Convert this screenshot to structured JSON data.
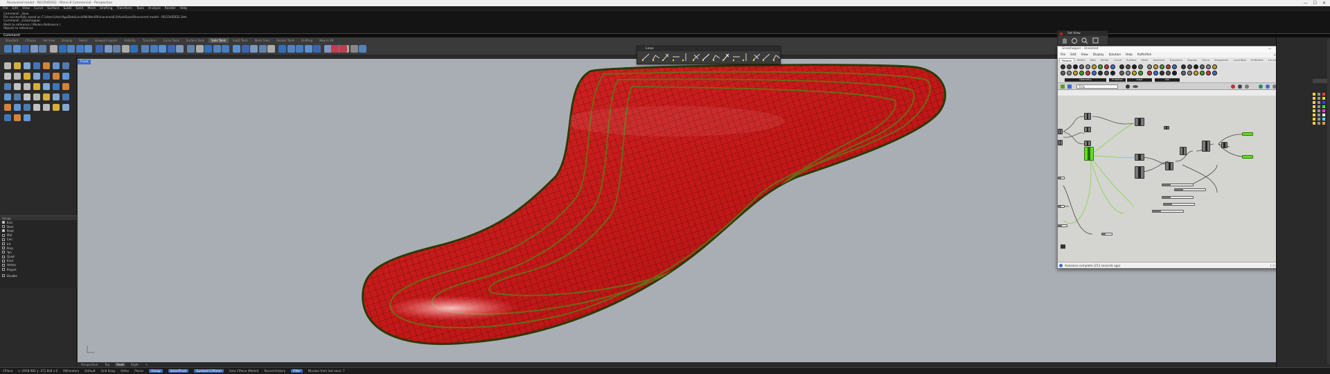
{
  "window": {
    "title": "Recovered model - RECOVERED - Rhino 8 Commercial - Perspective",
    "controls": [
      "—",
      "☐",
      "✕"
    ]
  },
  "menubar": [
    "File",
    "Edit",
    "View",
    "Curve",
    "Surface",
    "SubD",
    "Solid",
    "Mesh",
    "Drafting",
    "Transform",
    "Tools",
    "Analyze",
    "Render",
    "Help"
  ],
  "command_history": [
    "Command: _Save",
    "File successfully saved as C:\\Users\\User\\AppData\\Local\\McNeel\\Rhinoceros\\8.0\\AutoSave\\Recovered model - RECOVERED.3dm",
    "Command: _Grasshopper",
    "Mesh to reference ( Model=Reference )",
    "Objects to reference"
  ],
  "command_prompt": "Command:",
  "toolbar_tabs": [
    "Standard",
    "CPlanes",
    "Set View",
    "Display",
    "Select",
    "Viewport Layout",
    "Visibility",
    "Transform",
    "Curve Tools",
    "Surface Tools",
    "Solid Tools",
    "SubD Tools",
    "Mesh Tools",
    "Render Tools",
    "Drafting",
    "New in V8"
  ],
  "toolbar_active_tab": "Solid Tools",
  "osnap": {
    "header": "Osnap",
    "items": [
      {
        "label": "End",
        "on": true
      },
      {
        "label": "Near",
        "on": false
      },
      {
        "label": "Point",
        "on": true
      },
      {
        "label": "Mid",
        "on": false
      },
      {
        "label": "Cen",
        "on": false
      },
      {
        "label": "Int",
        "on": false
      },
      {
        "label": "Perp",
        "on": false
      },
      {
        "label": "Tan",
        "on": false
      },
      {
        "label": "Quad",
        "on": false
      },
      {
        "label": "Knot",
        "on": false
      },
      {
        "label": "Vertex",
        "on": false
      },
      {
        "label": "Project",
        "on": false
      }
    ],
    "disable_label": "Disable"
  },
  "viewport": {
    "name": "Front",
    "tabs": [
      "Perspective",
      "Top",
      "Front",
      "Right"
    ],
    "active_tab": "Front",
    "add_tab": "+"
  },
  "statusbar": {
    "cplane": "CPlane",
    "coords": "x -2958.982  y -371.844  z 0",
    "units": "Millimeters",
    "layer": "Default",
    "grid_snap": "Grid Snap",
    "ortho": "Ortho",
    "planar": "Planar",
    "osnap": "Osnap",
    "smarttrack": "SmartTrack",
    "gumball": "Gumball (CPlane)",
    "auto_cplane": "Auto CPlane (Model)",
    "record_history": "Record History",
    "filter": "Filter",
    "message": "Minutes from last save: 7"
  },
  "lines_toolbar": {
    "title": "Lines",
    "icon_count": 14
  },
  "set_view_panel": {
    "title": "Set View"
  },
  "grasshopper": {
    "title": "Grasshopper - Unnamed",
    "menu": [
      "File",
      "Edit",
      "View",
      "Display",
      "Solution",
      "Help",
      "Pufferfish"
    ],
    "menu_right": "Unnamed",
    "tabs": [
      "Params",
      "Maths",
      "Sets",
      "Vector",
      "Curve",
      "Surface",
      "Mesh",
      "Intersect",
      "Transform",
      "Display",
      "Rhino",
      "Kangaroo2",
      "LunchBox",
      "Pufferfish",
      "LunchBoxML"
    ],
    "active_tab": "Params",
    "ribbon_groups": [
      "Geometry",
      "Primitive",
      "Input",
      "Util"
    ],
    "zoom": "71%",
    "status": "Autosave complete (213 seconds ago)",
    "version": "1.0.0007"
  },
  "colors": {
    "viewport_bg": "#a9aeb4",
    "surface_red": "#c51a1a",
    "edge_green": "#4a5a10",
    "accent_blue": "#3b6fc7",
    "gh_selected": "#64dc1e",
    "gh_orange": "#f08c1e"
  },
  "layers_panel_icons": [
    "lightbulb-icon",
    "lock-icon",
    "color-swatch-icon"
  ]
}
